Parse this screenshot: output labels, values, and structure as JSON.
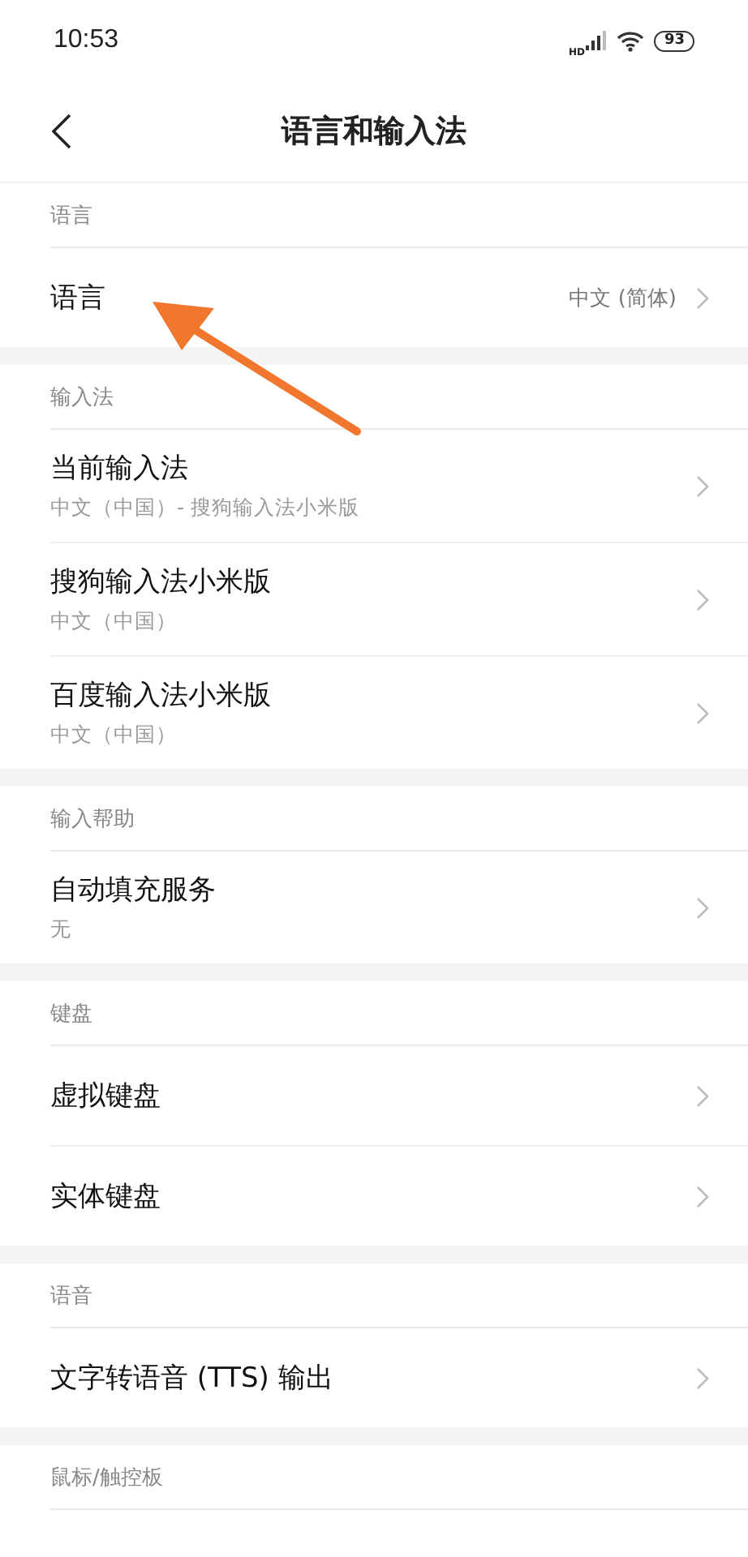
{
  "status_bar": {
    "time": "10:53",
    "network": "HD",
    "battery": "93"
  },
  "header": {
    "title": "语言和输入法"
  },
  "sections": [
    {
      "title": "语言",
      "items": [
        {
          "title": "语言",
          "value": "中文 (简体)"
        }
      ]
    },
    {
      "title": "输入法",
      "items": [
        {
          "title": "当前输入法",
          "subtitle": "中文（中国）- 搜狗输入法小米版"
        },
        {
          "title": "搜狗输入法小米版",
          "subtitle": "中文（中国）"
        },
        {
          "title": "百度输入法小米版",
          "subtitle": "中文（中国）"
        }
      ]
    },
    {
      "title": "输入帮助",
      "items": [
        {
          "title": "自动填充服务",
          "subtitle": "无"
        }
      ]
    },
    {
      "title": "键盘",
      "items": [
        {
          "title": "虚拟键盘"
        },
        {
          "title": "实体键盘"
        }
      ]
    },
    {
      "title": "语音",
      "items": [
        {
          "title": "文字转语音 (TTS) 输出"
        }
      ]
    },
    {
      "title": "鼠标/触控板"
    }
  ]
}
